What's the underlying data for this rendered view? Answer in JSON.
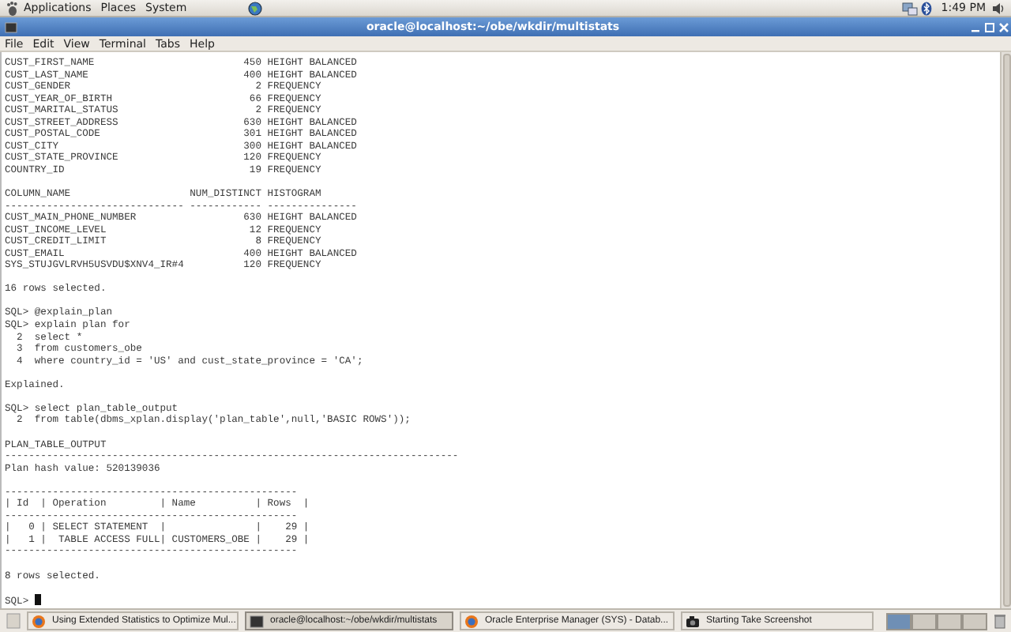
{
  "top_panel": {
    "menus": [
      "Applications",
      "Places",
      "System"
    ],
    "clock": "1:49 PM"
  },
  "window": {
    "title": "oracle@localhost:~/obe/wkdir/multistats"
  },
  "menu_bar": [
    "File",
    "Edit",
    "View",
    "Terminal",
    "Tabs",
    "Help"
  ],
  "terminal": {
    "blocks": [
      {
        "kind": "stats",
        "rows": [
          {
            "column_name": "CUST_FIRST_NAME",
            "num_distinct": "450",
            "histogram": "HEIGHT BALANCED"
          },
          {
            "column_name": "CUST_LAST_NAME",
            "num_distinct": "400",
            "histogram": "HEIGHT BALANCED"
          },
          {
            "column_name": "CUST_GENDER",
            "num_distinct": "2",
            "histogram": "FREQUENCY"
          },
          {
            "column_name": "CUST_YEAR_OF_BIRTH",
            "num_distinct": "66",
            "histogram": "FREQUENCY"
          },
          {
            "column_name": "CUST_MARITAL_STATUS",
            "num_distinct": "2",
            "histogram": "FREQUENCY"
          },
          {
            "column_name": "CUST_STREET_ADDRESS",
            "num_distinct": "630",
            "histogram": "HEIGHT BALANCED"
          },
          {
            "column_name": "CUST_POSTAL_CODE",
            "num_distinct": "301",
            "histogram": "HEIGHT BALANCED"
          },
          {
            "column_name": "CUST_CITY",
            "num_distinct": "300",
            "histogram": "HEIGHT BALANCED"
          },
          {
            "column_name": "CUST_STATE_PROVINCE",
            "num_distinct": "120",
            "histogram": "FREQUENCY"
          },
          {
            "column_name": "COUNTRY_ID",
            "num_distinct": "19",
            "histogram": "FREQUENCY"
          }
        ]
      },
      {
        "kind": "stats",
        "rows": [
          {
            "column_name": "COLUMN_NAME",
            "num_distinct": "NUM_DISTINCT",
            "histogram": "HISTOGRAM"
          },
          {
            "column_name": "------------------------------",
            "num_distinct": "------------",
            "histogram": "---------------"
          },
          {
            "column_name": "CUST_MAIN_PHONE_NUMBER",
            "num_distinct": "630",
            "histogram": "HEIGHT BALANCED"
          },
          {
            "column_name": "CUST_INCOME_LEVEL",
            "num_distinct": "12",
            "histogram": "FREQUENCY"
          },
          {
            "column_name": "CUST_CREDIT_LIMIT",
            "num_distinct": "8",
            "histogram": "FREQUENCY"
          },
          {
            "column_name": "CUST_EMAIL",
            "num_distinct": "400",
            "histogram": "HEIGHT BALANCED"
          },
          {
            "column_name": "SYS_STUJGVLRVH5USVDU$XNV4_IR#4",
            "num_distinct": "120",
            "histogram": "FREQUENCY"
          }
        ]
      },
      {
        "kind": "lines",
        "lines": [
          "16 rows selected."
        ]
      },
      {
        "kind": "lines",
        "lines": [
          "SQL> @explain_plan",
          "SQL> explain plan for",
          "  2  select *",
          "  3  from customers_obe",
          "  4  where country_id = 'US' and cust_state_province = 'CA';"
        ]
      },
      {
        "kind": "lines",
        "lines": [
          "Explained."
        ]
      },
      {
        "kind": "lines",
        "lines": [
          "SQL> select plan_table_output",
          "  2  from table(dbms_xplan.display('plan_table',null,'BASIC ROWS'));"
        ]
      },
      {
        "kind": "lines",
        "lines": [
          "PLAN_TABLE_OUTPUT",
          "----------------------------------------------------------------------------",
          "Plan hash value: 520139036"
        ]
      },
      {
        "kind": "lines",
        "lines": [
          "-------------------------------------------------",
          "| Id  | Operation         | Name          | Rows  |",
          "-------------------------------------------------",
          "|   0 | SELECT STATEMENT  |               |    29 |",
          "|   1 |  TABLE ACCESS FULL| CUSTOMERS_OBE |    29 |",
          "-------------------------------------------------"
        ]
      },
      {
        "kind": "lines",
        "lines": [
          "8 rows selected."
        ]
      },
      {
        "kind": "prompt",
        "text": "SQL>",
        "cursor": true
      }
    ]
  },
  "taskbar": {
    "items": [
      {
        "kind": "browser",
        "label": "Using Extended Statistics to Optimize Mul...",
        "selected": false
      },
      {
        "kind": "terminal",
        "label": "oracle@localhost:~/obe/wkdir/multistats",
        "selected": true
      },
      {
        "kind": "browser",
        "label": "Oracle Enterprise Manager (SYS) - Datab...",
        "selected": false
      },
      {
        "kind": "camera",
        "label": "Starting Take Screenshot",
        "selected": false
      }
    ],
    "workspaces": [
      {
        "selected": true
      },
      {
        "selected": false
      },
      {
        "selected": false
      },
      {
        "selected": false
      }
    ]
  }
}
